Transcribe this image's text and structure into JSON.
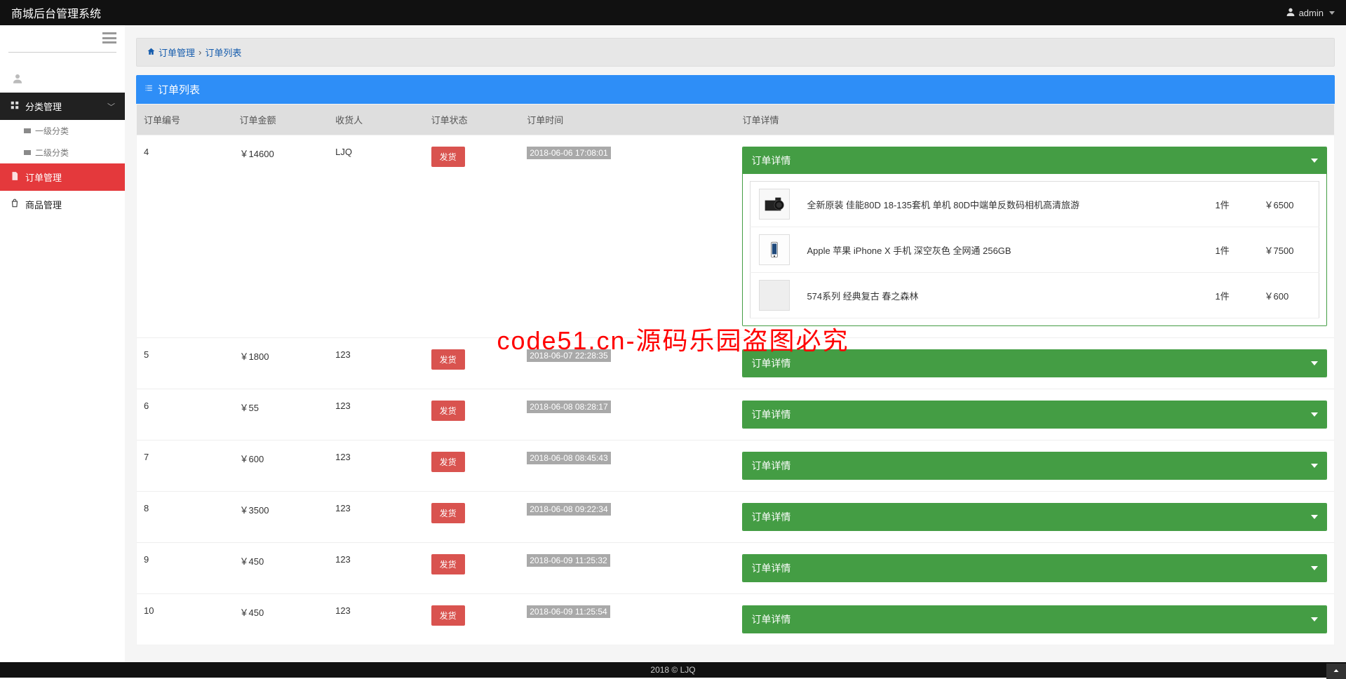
{
  "app": {
    "title": "商城后台管理系统",
    "user": "admin"
  },
  "sidebar": {
    "items": [
      {
        "label": "分类管理",
        "kind": "dark",
        "children": [
          {
            "label": "一级分类"
          },
          {
            "label": "二级分类"
          }
        ]
      },
      {
        "label": "订单管理",
        "kind": "active"
      },
      {
        "label": "商品管理",
        "kind": "plain"
      }
    ]
  },
  "breadcrumb": {
    "a": "订单管理",
    "b": "订单列表"
  },
  "panel": {
    "title": "订单列表"
  },
  "table": {
    "headers": {
      "id": "订单编号",
      "amount": "订单金额",
      "receiver": "收货人",
      "status": "订单状态",
      "time": "订单时间",
      "detail": "订单详情"
    },
    "ship_btn": "发货",
    "detail_label": "订单详情",
    "rows": [
      {
        "id": "4",
        "amount": "￥14600",
        "receiver": "LJQ",
        "time": "2018-06-06 17:08:01",
        "expanded": true,
        "items": [
          {
            "name": "全新原装 佳能80D 18-135套机 单机 80D中端单反数码相机高清旅游",
            "qty": "1件",
            "price": "￥6500",
            "thumb": "camera"
          },
          {
            "name": "Apple 苹果 iPhone X 手机 深空灰色 全网通 256GB",
            "qty": "1件",
            "price": "￥7500",
            "thumb": "phone"
          },
          {
            "name": "574系列 经典复古 春之森林",
            "qty": "1件",
            "price": "￥600",
            "thumb": "blank"
          }
        ]
      },
      {
        "id": "5",
        "amount": "￥1800",
        "receiver": "123",
        "time": "2018-06-07 22:28:35",
        "expanded": false
      },
      {
        "id": "6",
        "amount": "￥55",
        "receiver": "123",
        "time": "2018-06-08 08:28:17",
        "expanded": false
      },
      {
        "id": "7",
        "amount": "￥600",
        "receiver": "123",
        "time": "2018-06-08 08:45:43",
        "expanded": false
      },
      {
        "id": "8",
        "amount": "￥3500",
        "receiver": "123",
        "time": "2018-06-08 09:22:34",
        "expanded": false
      },
      {
        "id": "9",
        "amount": "￥450",
        "receiver": "123",
        "time": "2018-06-09 11:25:32",
        "expanded": false
      },
      {
        "id": "10",
        "amount": "￥450",
        "receiver": "123",
        "time": "2018-06-09 11:25:54",
        "expanded": false
      }
    ]
  },
  "footer": "2018 © LJQ",
  "watermark": "code51.cn-源码乐园盗图必究"
}
